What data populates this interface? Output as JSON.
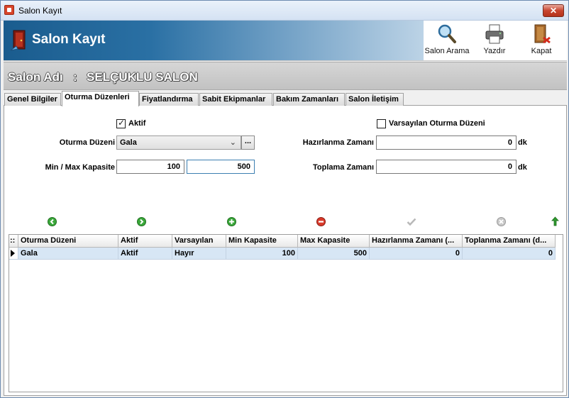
{
  "window": {
    "title": "Salon Kayıt",
    "close_glyph": "✕"
  },
  "header": {
    "title": "Salon Kayıt",
    "buttons": [
      {
        "label": "Salon Arama",
        "icon": "magnifier-icon"
      },
      {
        "label": "Yazdır",
        "icon": "printer-icon"
      },
      {
        "label": "Kapat",
        "icon": "exit-door-icon"
      }
    ]
  },
  "salon": {
    "label": "Salon Adı",
    "separator": ":",
    "name": "SELÇUKLU SALON"
  },
  "tabs": [
    {
      "label": "Genel Bilgiler",
      "active": false
    },
    {
      "label": "Oturma Düzenleri",
      "active": true
    },
    {
      "label": "Fiyatlandırma",
      "active": false
    },
    {
      "label": "Sabit Ekipmanlar",
      "active": false
    },
    {
      "label": "Bakım Zamanları",
      "active": false
    },
    {
      "label": "Salon İletişim",
      "active": false
    }
  ],
  "form": {
    "aktif": {
      "label": "Aktif",
      "checked": true
    },
    "varsayilan": {
      "label": "Varsayılan Oturma Düzeni",
      "checked": false
    },
    "oturma_duzeni": {
      "label": "Oturma Düzeni",
      "value": "Gala",
      "button": "..."
    },
    "kapasite": {
      "label": "Min / Max Kapasite",
      "min": "100",
      "max": "500"
    },
    "hazirlanma": {
      "label": "Hazırlanma Zamanı",
      "value": "0",
      "unit": "dk"
    },
    "toplama": {
      "label": "Toplama Zamanı",
      "value": "0",
      "unit": "dk"
    }
  },
  "navigator": [
    {
      "icon": "first-record-icon",
      "color": "#3aa83a"
    },
    {
      "icon": "next-record-icon",
      "color": "#3aa83a"
    },
    {
      "icon": "add-record-icon",
      "color": "#3aa83a"
    },
    {
      "icon": "delete-record-icon",
      "color": "#d93a2b"
    },
    {
      "icon": "save-record-icon",
      "color": "#b8b8b8"
    },
    {
      "icon": "cancel-record-icon",
      "color": "#b8b8b8"
    },
    {
      "icon": "up-arrow-icon",
      "color": "#2f9b2f"
    }
  ],
  "grid": {
    "columns": [
      "Oturma Düzeni",
      "Aktif",
      "Varsayılan",
      "Min Kapasite",
      "Max Kapasite",
      "Hazırlanma Zamanı (...",
      "Toplanma Zamanı (d..."
    ],
    "rows": [
      [
        "Gala",
        "Aktif",
        "Hayır",
        "100",
        "500",
        "0",
        "0"
      ]
    ]
  }
}
